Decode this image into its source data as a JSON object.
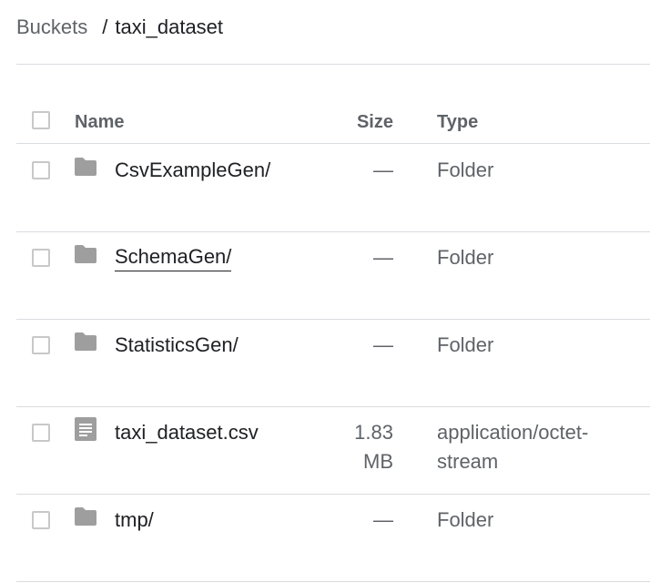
{
  "breadcrumb": {
    "root": "Buckets",
    "separator": "/",
    "current": "taxi_dataset"
  },
  "table": {
    "columns": {
      "name": "Name",
      "size": "Size",
      "type": "Type"
    },
    "rows": [
      {
        "name": "CsvExampleGen/",
        "size": "—",
        "type": "Folder",
        "icon": "folder-icon"
      },
      {
        "name": "SchemaGen/",
        "size": "—",
        "type": "Folder",
        "icon": "folder-icon"
      },
      {
        "name": "StatisticsGen/",
        "size": "—",
        "type": "Folder",
        "icon": "folder-icon"
      },
      {
        "name": "taxi_dataset.csv",
        "size": "1.83 MB",
        "type": "application/octet-stream",
        "icon": "file-icon"
      },
      {
        "name": "tmp/",
        "size": "—",
        "type": "Folder",
        "icon": "folder-icon"
      }
    ]
  },
  "colors": {
    "divider": "#dadce0",
    "icon_gray": "#9e9e9e",
    "text_secondary": "#5f6368",
    "text_primary": "#202124"
  }
}
